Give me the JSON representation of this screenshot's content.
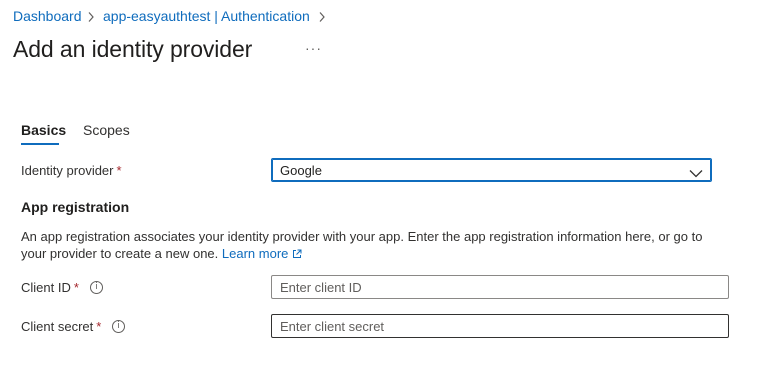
{
  "breadcrumb": {
    "items": [
      "Dashboard",
      "app-easyauthtest | Authentication"
    ],
    "separator": ">"
  },
  "page": {
    "title": "Add an identity provider",
    "more_actions": "···"
  },
  "tabs": [
    {
      "label": "Basics",
      "active": true
    },
    {
      "label": "Scopes",
      "active": false
    }
  ],
  "form": {
    "identity_provider": {
      "label": "Identity provider",
      "required_mark": "*",
      "selected_value": "Google"
    },
    "app_registration": {
      "heading": "App registration",
      "description": "An app registration associates your identity provider with your app. Enter the app registration information here, or go to your provider to create a new one.",
      "learn_more": "Learn more"
    },
    "client_id": {
      "label": "Client ID",
      "required_mark": "*",
      "placeholder": "Enter client ID",
      "value": ""
    },
    "client_secret": {
      "label": "Client secret",
      "required_mark": "*",
      "placeholder": "Enter client secret",
      "value": ""
    }
  },
  "colors": {
    "accent": "#0f6cbd",
    "required": "#a4262c",
    "text": "#323130"
  },
  "icons": {
    "breadcrumb_separator": "chevron-right-icon",
    "dropdown": "chevron-down-icon",
    "info": "info-icon",
    "external_link": "external-link-icon"
  }
}
